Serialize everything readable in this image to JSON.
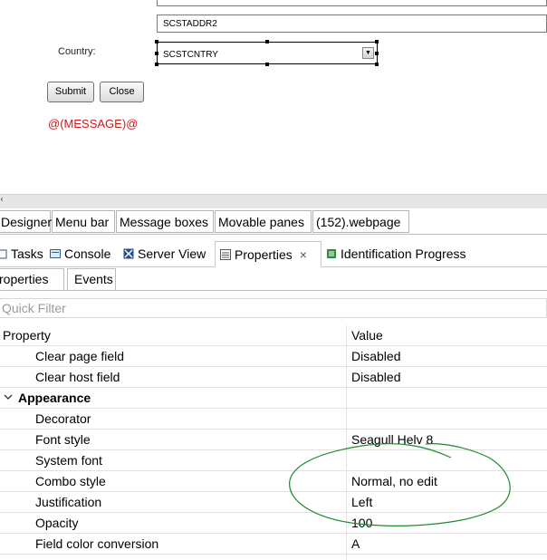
{
  "form": {
    "addr2_value": "SCSTADDR2",
    "country_label": "Country:",
    "country_value": "SCSTCNTRY",
    "submit_label": "Submit",
    "close_label": "Close",
    "message": "@(MESSAGE)@"
  },
  "editor_tabs": [
    "Designer",
    "Menu bar",
    "Message boxes",
    "Movable panes",
    "(152).webpage"
  ],
  "view_tabs": {
    "tasks": "Tasks",
    "console": "Console",
    "server_view": "Server View",
    "properties": "Properties",
    "close_glyph": "×",
    "identification": "Identification Progress"
  },
  "sub_tabs": {
    "properties": "roperties",
    "events": "Events"
  },
  "filter": {
    "placeholder": "Quick Filter"
  },
  "table": {
    "col_property": "Property",
    "col_value": "Value",
    "rows": [
      {
        "name": "Clear page field",
        "value": "Disabled"
      },
      {
        "name": "Clear host field",
        "value": "Disabled"
      },
      {
        "name": "Appearance",
        "value": ""
      },
      {
        "name": "Decorator",
        "value": ""
      },
      {
        "name": "Font style",
        "value": "Seagull Helv 8"
      },
      {
        "name": "System font",
        "value": ""
      },
      {
        "name": "Combo style",
        "value": "Normal, no edit"
      },
      {
        "name": "Justification",
        "value": "Left"
      },
      {
        "name": "Opacity",
        "value": "100"
      },
      {
        "name": "Field color conversion",
        "value": "A"
      }
    ]
  },
  "colors": {
    "message_red": "#d01818",
    "annotation_green": "#1f8a2c"
  }
}
